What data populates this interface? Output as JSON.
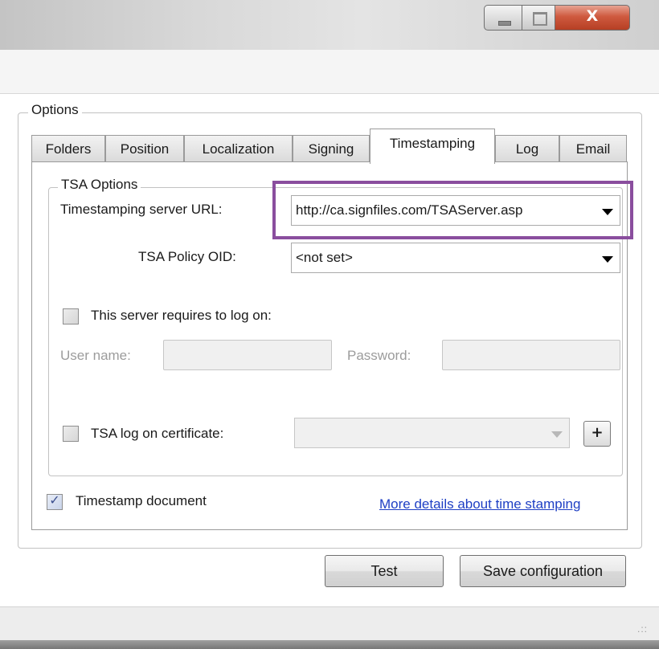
{
  "window": {
    "controls": {
      "minimize": "minimize",
      "maximize": "maximize",
      "close_glyph": "X"
    }
  },
  "options": {
    "group_label": "Options",
    "tabs": [
      {
        "label": "Folders"
      },
      {
        "label": "Position"
      },
      {
        "label": "Localization"
      },
      {
        "label": "Signing"
      },
      {
        "label": "Timestamping",
        "active": true
      },
      {
        "label": "Log"
      },
      {
        "label": "Email"
      }
    ]
  },
  "tsa": {
    "group_label": "TSA Options",
    "server_url_label": "Timestamping server URL:",
    "server_url_value": "http://ca.signfiles.com/TSAServer.asp",
    "policy_oid_label": "TSA Policy OID:",
    "policy_oid_value": "<not set>",
    "requires_logon_label": "This server requires to log on:",
    "requires_logon_checked": false,
    "username_label": "User name:",
    "username_value": "",
    "password_label": "Password:",
    "password_value": "",
    "cert_label": "TSA log on certificate:",
    "cert_checked": false,
    "cert_value": "",
    "plus_label": "+"
  },
  "timestamp_document": {
    "label": "Timestamp document",
    "checked": true,
    "check_glyph": "✓"
  },
  "details_link": "More details about time stamping",
  "buttons": {
    "test": "Test",
    "save": "Save configuration"
  },
  "statusbar": {
    "grip": ".::"
  },
  "colors": {
    "highlight": "#8a4e9e",
    "link": "#1e3fc4",
    "close_button": "#c9503a"
  }
}
